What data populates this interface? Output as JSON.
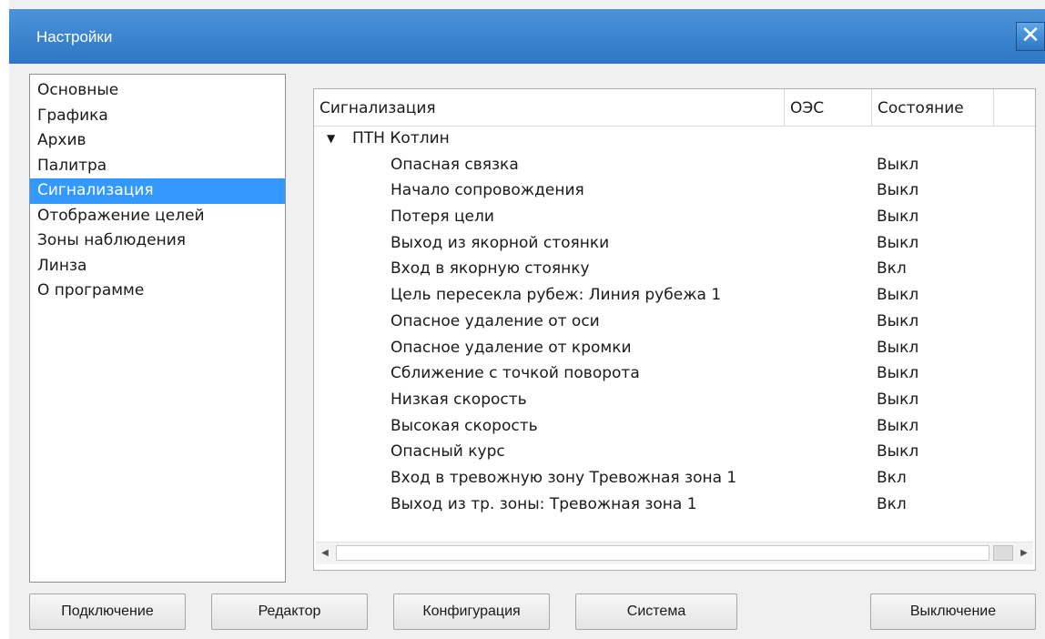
{
  "window": {
    "title": "Настройки",
    "close_glyph": "✕"
  },
  "sidebar": {
    "items": [
      {
        "label": "Основные"
      },
      {
        "label": "Графика"
      },
      {
        "label": "Архив"
      },
      {
        "label": "Палитра"
      },
      {
        "label": "Сигнализация",
        "selected": true
      },
      {
        "label": "Отображение целей"
      },
      {
        "label": "Зоны наблюдения"
      },
      {
        "label": "Линза"
      },
      {
        "label": "О программе"
      }
    ]
  },
  "alarm_table": {
    "columns": [
      "Сигнализация",
      "ОЭС",
      "Состояние"
    ],
    "group": {
      "name": "ПТН Котлин",
      "expanded": true
    },
    "rows": [
      {
        "name": "Опасная связка",
        "state": "Выкл"
      },
      {
        "name": "Начало сопровождения",
        "state": "Выкл"
      },
      {
        "name": "Потеря цели",
        "state": "Выкл"
      },
      {
        "name": "Выход из якорной стоянки",
        "state": "Выкл"
      },
      {
        "name": "Вход в якорную стоянку",
        "state": "Вкл"
      },
      {
        "name": "Цель пересекла рубеж: Линия рубежа 1",
        "state": "Выкл"
      },
      {
        "name": "Опасное удаление от оси",
        "state": "Выкл"
      },
      {
        "name": "Опасное удаление от кромки",
        "state": "Выкл"
      },
      {
        "name": "Сближение с точкой поворота",
        "state": "Выкл"
      },
      {
        "name": "Низкая скорость",
        "state": "Выкл"
      },
      {
        "name": "Высокая скорость",
        "state": "Выкл"
      },
      {
        "name": "Опасный курс",
        "state": "Выкл"
      },
      {
        "name": "Вход в тревожную зону Тревожная зона 1",
        "state": "Вкл"
      },
      {
        "name": "Выход из тр. зоны: Тревожная зона 1",
        "state": "Вкл"
      }
    ]
  },
  "buttons": {
    "connect": "Подключение",
    "editor": "Редактор",
    "config": "Конфигурация",
    "system": "Система",
    "shutdown": "Выключение"
  },
  "colors": {
    "title_bar": "#2e77c5",
    "selection": "#3399ff"
  }
}
